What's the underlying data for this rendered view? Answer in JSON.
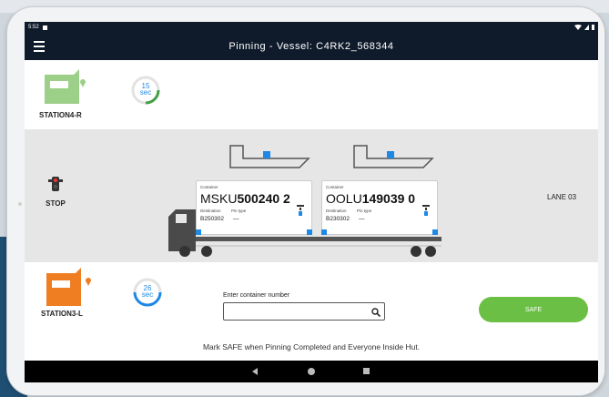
{
  "status_bar": {
    "time": "5:52"
  },
  "app_bar": {
    "title": "Pinning - Vessel: C4RK2_568344"
  },
  "station_top": {
    "label": "STATION4-R",
    "timer_value": "15",
    "timer_unit": "sec",
    "timer_progress": 0.3
  },
  "lane": {
    "stop_label": "STOP",
    "lane_label": "LANE 03",
    "containers": [
      {
        "label": "Container",
        "prefix": "MSKU",
        "number": "500240 2",
        "dest_label": "Destination",
        "dest": "B250302",
        "pin_label": "Pin type",
        "pin": "—"
      },
      {
        "label": "Container",
        "prefix": "OOLU",
        "number": "149039 0",
        "dest_label": "Destination",
        "dest": "B230302",
        "pin_label": "Pin type",
        "pin": "—"
      }
    ]
  },
  "station_bottom": {
    "label": "STATION3-L",
    "timer_value": "26",
    "timer_unit": "sec",
    "timer_progress": 0.55
  },
  "search": {
    "label": "Enter container number",
    "value": "",
    "placeholder": ""
  },
  "safe_button": {
    "label": "SAFE"
  },
  "instruction": "Mark SAFE when Pinning Completed and Everyone Inside Hut.",
  "colors": {
    "app_bar": "#0f1b2b",
    "safe": "#6bbf44",
    "accent": "#1e88e5",
    "station_top": "#9ccf87",
    "station_bottom": "#ef7d22"
  },
  "icons": [
    "menu-icon",
    "station-hut-icon",
    "timer-ring-icon",
    "traffic-light-icon",
    "ship-icon",
    "truck-icon",
    "search-icon",
    "nav-back-icon",
    "nav-home-icon",
    "nav-recent-icon"
  ]
}
